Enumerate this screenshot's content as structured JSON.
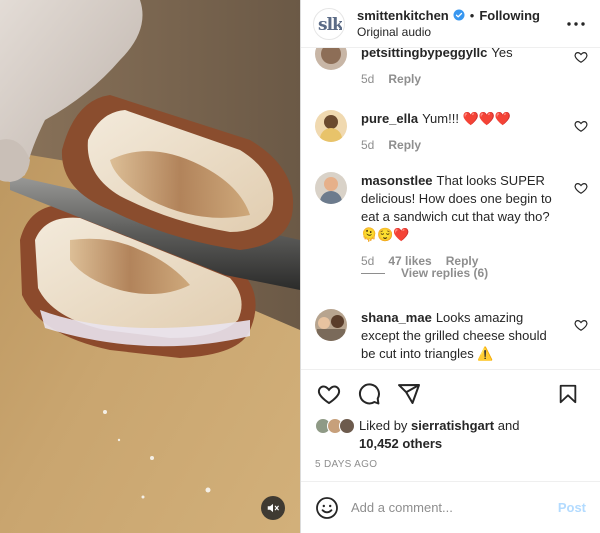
{
  "header": {
    "username": "smittenkitchen",
    "separator": "•",
    "follow_label": "Following",
    "subtitle": "Original audio",
    "avatar_icon": "smitten-kitchen-logo",
    "more_icon": "more-horizontal-icon"
  },
  "comments": [
    {
      "username": "petsittingbypeggyllc",
      "text": "Yes",
      "time": "5d",
      "reply_label": "Reply"
    },
    {
      "username": "pure_ella",
      "text": "Yum!!! ❤️❤️❤️",
      "time": "5d",
      "reply_label": "Reply"
    },
    {
      "username": "masonstlee",
      "text": "That looks SUPER delicious! How does one begin to eat a sandwich cut that way tho? 🫠😌❤️",
      "time": "5d",
      "likes": "47 likes",
      "reply_label": "Reply"
    },
    {
      "username": "shana_mae",
      "text": "Looks amazing except the grilled cheese should be cut into triangles ⚠️"
    }
  ],
  "view_replies": "View replies (6)",
  "actions": {
    "like_icon": "heart-icon",
    "comment_icon": "comment-icon",
    "share_icon": "share-icon",
    "save_icon": "bookmark-icon"
  },
  "likes": {
    "prefix": "Liked by",
    "user": "sierratishgart",
    "connector": "and",
    "others": "10,452 others"
  },
  "date": "5 days ago",
  "composer": {
    "placeholder": "Add a comment...",
    "post_label": "Post",
    "emoji_icon": "emoji-icon"
  },
  "media": {
    "mute_icon": "speaker-muted-icon"
  },
  "colors": {
    "verified": "#3897f0",
    "post_disabled": "#b3dbff",
    "muted_text": "#8e8e8e",
    "heart_red": "#ed4956"
  }
}
